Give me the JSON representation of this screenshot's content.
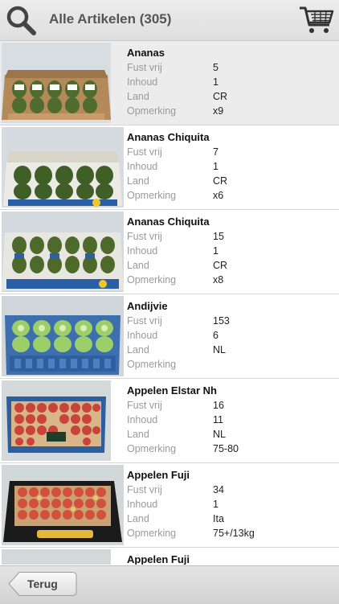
{
  "header": {
    "title": "Alle Artikelen (305)",
    "search_icon": "search-icon",
    "cart_icon": "shopping-cart-icon"
  },
  "labels": {
    "fust_vrij": "Fust vrij",
    "inhoud": "Inhoud",
    "land": "Land",
    "opmerking": "Opmerking"
  },
  "items": [
    {
      "name": "Ananas",
      "fust_vrij": "5",
      "inhoud": "1",
      "land": "CR",
      "opmerking": "x9"
    },
    {
      "name": "Ananas Chiquita",
      "fust_vrij": "7",
      "inhoud": "1",
      "land": "CR",
      "opmerking": "x6"
    },
    {
      "name": "Ananas Chiquita",
      "fust_vrij": "15",
      "inhoud": "1",
      "land": "CR",
      "opmerking": "x8"
    },
    {
      "name": "Andijvie",
      "fust_vrij": "153",
      "inhoud": "6",
      "land": "NL",
      "opmerking": ""
    },
    {
      "name": "Appelen Elstar Nh",
      "fust_vrij": "16",
      "inhoud": "11",
      "land": "NL",
      "opmerking": "75-80"
    },
    {
      "name": "Appelen Fuji",
      "fust_vrij": "34",
      "inhoud": "1",
      "land": "Ita",
      "opmerking": "75+/13kg"
    },
    {
      "name": "Appelen Fuji"
    }
  ],
  "footer": {
    "back_label": "Terug"
  },
  "colors": {
    "header_bg": "#e6e6e6",
    "selected_row_bg": "#ececec",
    "label_gray": "#9a9a9a"
  }
}
